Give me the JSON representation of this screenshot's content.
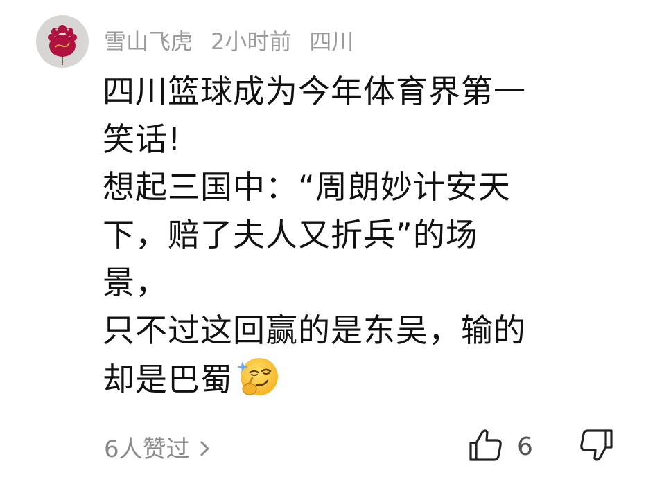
{
  "comment": {
    "author": "雪山飞虎",
    "time": "2小时前",
    "location": "四川",
    "lines": [
      "四川篮球成为今年体育界第一",
      "笑话!",
      "想起三国中：“周朗妙计安天",
      "下，赔了夫人又折兵”的场",
      "景，",
      "只不过这回赢的是东吴，输的",
      "却是巴蜀"
    ],
    "emoji": "smirk-thinking-emoji",
    "likers_summary": "6人赞过",
    "like_count": "6"
  },
  "colors": {
    "meta_text": "#9b9b9b",
    "body_text": "#111111",
    "avatar_bg": "#d8d6d4",
    "avatar_flower": "#b0123f"
  },
  "icons": {
    "avatar": "red-flower-avatar",
    "likers_chevron": "chevron-right-icon",
    "like": "thumbs-up-icon",
    "dislike": "thumbs-down-icon"
  }
}
